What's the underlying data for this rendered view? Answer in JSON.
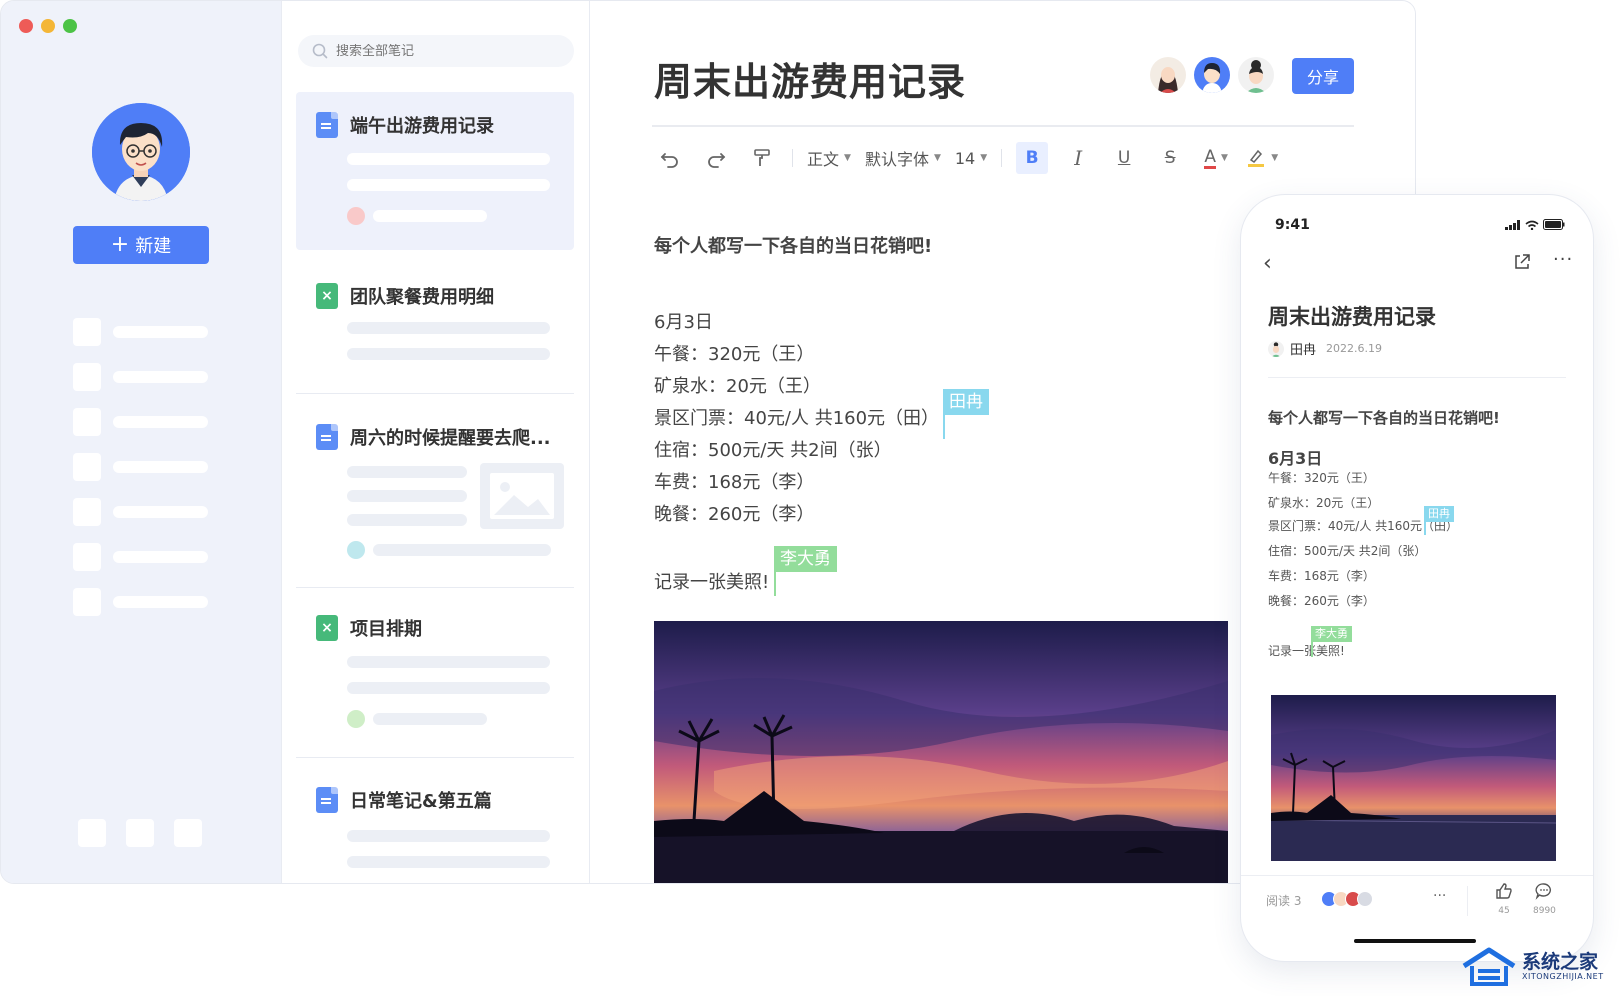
{
  "window": {
    "traffic_colors": [
      "#ee5b57",
      "#f4b636",
      "#4cc346"
    ]
  },
  "rail": {
    "new_label": "新建",
    "row_count": 7
  },
  "notes": {
    "search_placeholder": "搜索全部笔记",
    "items": [
      {
        "title": "端午出游费用记录",
        "type": "word",
        "active": true,
        "dot_color": "#f9c9c9"
      },
      {
        "title": "团队聚餐费用明细",
        "type": "excel",
        "active": false
      },
      {
        "title": "周六的时候提醒要去爬...",
        "type": "word",
        "active": false,
        "dot_color": "#bfe8ee"
      },
      {
        "title": "项目排期",
        "type": "excel",
        "active": false,
        "dot_color": "#cfeec7"
      },
      {
        "title": "日常笔记&第五篇",
        "type": "word",
        "active": false
      }
    ]
  },
  "editor": {
    "title": "周末出游费用记录",
    "share_label": "分享",
    "toolbar": {
      "style": "正文",
      "font": "默认字体",
      "size": "14",
      "bold": "B",
      "italic": "I",
      "underline": "U",
      "strike": "S",
      "color": "A"
    },
    "intro": "每个人都写一下各自的当日花销吧!",
    "date": "6月3日",
    "lines": [
      "午餐：320元（王）",
      "矿泉水：20元（王）",
      "景区门票：40元/人  共160元（田）",
      "住宿：500元/天  共2间（张）",
      "车费：168元（李）",
      "晚餐：260元（李）"
    ],
    "photo_caption": "记录一张美照!",
    "tag_tian": "田冉",
    "tag_li": "李大勇",
    "accent": "#4f7ef7"
  },
  "phone": {
    "time": "9:41",
    "title": "周末出游费用记录",
    "author": "田冉",
    "date": "2022.6.19",
    "intro": "每个人都写一下各自的当日花销吧!",
    "day": "6月3日",
    "lines": [
      "午餐：320元（王）",
      "矿泉水：20元（王）",
      "景区门票：40元/人  共160元（田）",
      "住宿：500元/天  共2间（张）",
      "车费：168元（李）",
      "晚餐：260元（李）"
    ],
    "caption": "记录一张美照!",
    "tag_tian": "田冉",
    "tag_li": "李大勇",
    "read_label": "阅读 3",
    "likes": "45",
    "comments": "8990"
  },
  "watermark": {
    "title": "系统之家",
    "url": "XITONGZHIJIA.NET"
  }
}
